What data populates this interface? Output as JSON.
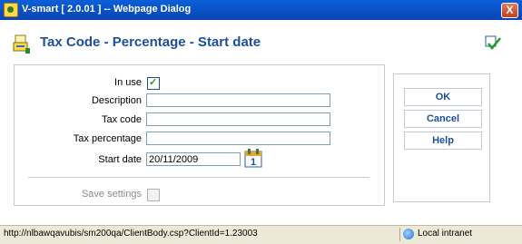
{
  "window": {
    "title": "V-smart [ 2.0.01 ] -- Webpage Dialog",
    "close_label": "X"
  },
  "header": {
    "title": "Tax Code - Percentage - Start date"
  },
  "form": {
    "in_use_label": "In use",
    "in_use_checked": true,
    "description_label": "Description",
    "description_value": "",
    "tax_code_label": "Tax code",
    "tax_code_value": "",
    "tax_percentage_label": "Tax percentage",
    "tax_percentage_value": "",
    "start_date_label": "Start date",
    "start_date_value": "20/11/2009",
    "save_settings_label": "Save settings",
    "save_settings_checked": false
  },
  "buttons": {
    "ok": "OK",
    "cancel": "Cancel",
    "help": "Help"
  },
  "statusbar": {
    "url": "http://nlbawqavubis/sm200qa/ClientBody.csp?ClientId=1.23003",
    "zone": "Local intranet"
  },
  "icons": {
    "app": "app-icon",
    "header": "tax-code-icon",
    "confirm": "check-icon",
    "calendar": "calendar-icon",
    "zone": "globe-icon"
  },
  "colors": {
    "title_text": "#1d4f9e",
    "titlebar": "#0b4fc4",
    "statusbar": "#ece9d8"
  }
}
